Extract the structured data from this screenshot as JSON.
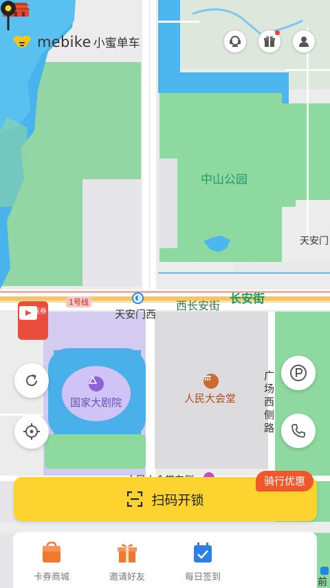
{
  "app": {
    "brand": "mebike",
    "brand_cn": "小蜜单车"
  },
  "header": {
    "buttons": [
      {
        "name": "service-icon",
        "has_badge": false
      },
      {
        "name": "gift-icon",
        "has_badge": true
      },
      {
        "name": "user-icon",
        "has_badge": false
      }
    ]
  },
  "map": {
    "labels": {
      "park": "中山公园",
      "tiananmen": "天安门",
      "line1": "1号线",
      "station": "天安门西",
      "xichangan": "西长安街",
      "changan": "长安街",
      "theater": "国家大剧院",
      "hall": "人民大会堂",
      "square": "广场西侧路",
      "dahuitang": "人民大会堂东侧",
      "qian": "前"
    },
    "shop_badge": "购物返券"
  },
  "actions": {
    "scan_label": "扫码开锁",
    "promo_tag": "骑行优惠"
  },
  "bottom": {
    "tiles": [
      {
        "label": "卡券商城",
        "icon": "voucher-bag-icon"
      },
      {
        "label": "邀请好友",
        "icon": "gift-box-icon"
      },
      {
        "label": "每日签到",
        "icon": "calendar-check-icon"
      }
    ]
  },
  "colors": {
    "accent_yellow": "#fdd32f",
    "promo_orange": "#f0582b",
    "park_green": "#8dd9a0",
    "water_blue": "#45b3ee"
  }
}
